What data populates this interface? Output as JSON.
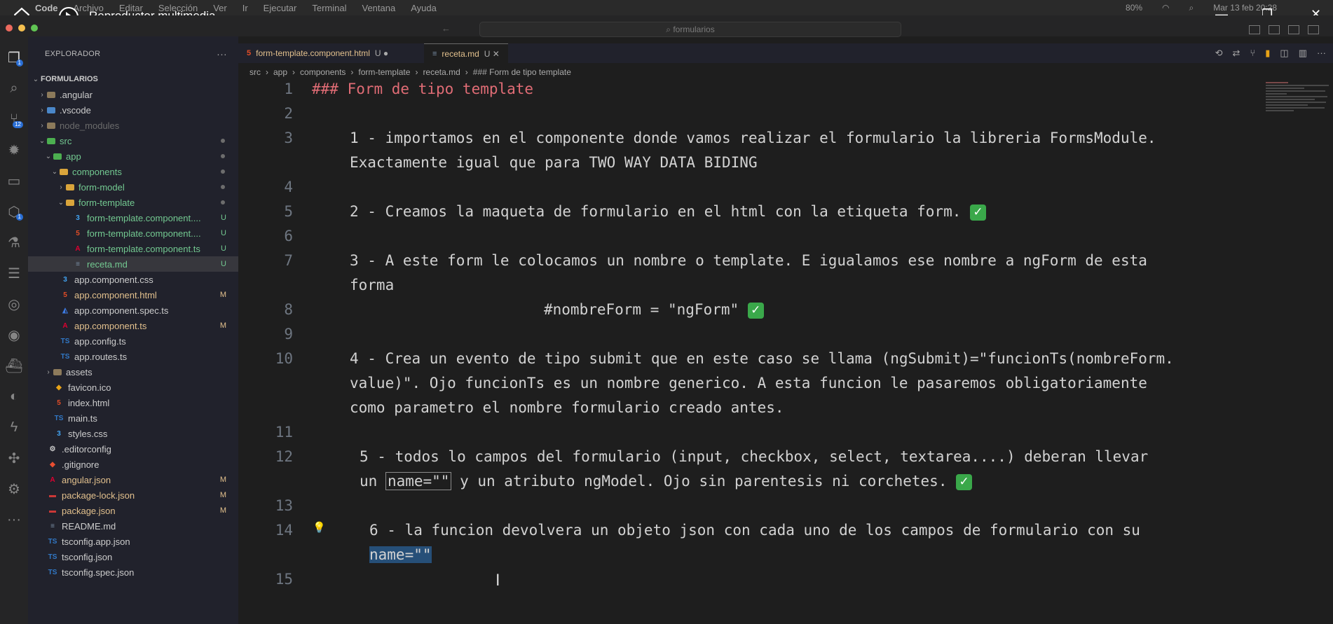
{
  "mac_menu": {
    "app": "Code",
    "items": [
      "Archivo",
      "Editar",
      "Selección",
      "Ver",
      "Ir",
      "Ejecutar",
      "Terminal",
      "Ventana",
      "Ayuda"
    ],
    "battery": "80%",
    "datetime": "Mar 13 feb 20:28"
  },
  "player": {
    "title": "Reproductor multimedia",
    "home_icon": "home-icon",
    "play_icon": "play-icon",
    "minimize": "—",
    "restore": "❐",
    "close": "✕"
  },
  "window": {
    "search_placeholder": "formularios"
  },
  "activity_bar": {
    "explorer_badge": "1",
    "scm_badge": "12",
    "remote_badge": "1",
    "more": "···"
  },
  "sidebar": {
    "title": "EXPLORADOR",
    "more": "···",
    "tree": [
      {
        "name": "FORMULARIOS",
        "icon": "",
        "chev": "⌄",
        "status": "",
        "indent": 0,
        "root": true
      },
      {
        "name": ".angular",
        "icon": "folder",
        "chev": "›",
        "status": "",
        "indent": 1
      },
      {
        "name": ".vscode",
        "icon": "folder-blue",
        "chev": "›",
        "status": "",
        "indent": 1
      },
      {
        "name": "node_modules",
        "icon": "folder",
        "chev": "›",
        "status": "",
        "indent": 1,
        "dim": true
      },
      {
        "name": "src",
        "icon": "folder-green",
        "chev": "⌄",
        "status": "dot",
        "indent": 1
      },
      {
        "name": "app",
        "icon": "folder-green",
        "chev": "⌄",
        "status": "dot",
        "indent": 2
      },
      {
        "name": "components",
        "icon": "folder-yellow",
        "chev": "⌄",
        "status": "dot",
        "indent": 3
      },
      {
        "name": "form-model",
        "icon": "folder-yellow",
        "chev": "›",
        "status": "dot",
        "indent": 4
      },
      {
        "name": "form-template",
        "icon": "folder-yellow",
        "chev": "⌄",
        "status": "dot",
        "indent": 4
      },
      {
        "name": "form-template.component....",
        "icon": "css",
        "chev": "",
        "status": "U",
        "indent": 5
      },
      {
        "name": "form-template.component....",
        "icon": "html",
        "chev": "",
        "status": "U",
        "indent": 5
      },
      {
        "name": "form-template.component.ts",
        "icon": "angular",
        "chev": "",
        "status": "U",
        "indent": 5
      },
      {
        "name": "receta.md",
        "icon": "md",
        "chev": "",
        "status": "U",
        "indent": 5,
        "selected": true
      },
      {
        "name": "app.component.css",
        "icon": "css",
        "chev": "",
        "status": "",
        "indent": 3
      },
      {
        "name": "app.component.html",
        "icon": "html",
        "chev": "",
        "status": "M",
        "indent": 3
      },
      {
        "name": "app.component.spec.ts",
        "icon": "spec",
        "chev": "",
        "status": "",
        "indent": 3
      },
      {
        "name": "app.component.ts",
        "icon": "angular",
        "chev": "",
        "status": "M",
        "indent": 3
      },
      {
        "name": "app.config.ts",
        "icon": "ts",
        "chev": "",
        "status": "",
        "indent": 3
      },
      {
        "name": "app.routes.ts",
        "icon": "ts",
        "chev": "",
        "status": "",
        "indent": 3
      },
      {
        "name": "assets",
        "icon": "folder",
        "chev": "›",
        "status": "",
        "indent": 2
      },
      {
        "name": "favicon.ico",
        "icon": "ico",
        "chev": "",
        "status": "",
        "indent": 2
      },
      {
        "name": "index.html",
        "icon": "html",
        "chev": "",
        "status": "",
        "indent": 2
      },
      {
        "name": "main.ts",
        "icon": "ts",
        "chev": "",
        "status": "",
        "indent": 2
      },
      {
        "name": "styles.css",
        "icon": "css",
        "chev": "",
        "status": "",
        "indent": 2
      },
      {
        "name": ".editorconfig",
        "icon": "gear",
        "chev": "",
        "status": "",
        "indent": 1
      },
      {
        "name": ".gitignore",
        "icon": "git",
        "chev": "",
        "status": "",
        "indent": 1
      },
      {
        "name": "angular.json",
        "icon": "angular",
        "chev": "",
        "status": "M",
        "indent": 1
      },
      {
        "name": "package-lock.json",
        "icon": "npm",
        "chev": "",
        "status": "M",
        "indent": 1
      },
      {
        "name": "package.json",
        "icon": "npm",
        "chev": "",
        "status": "M",
        "indent": 1
      },
      {
        "name": "README.md",
        "icon": "md",
        "chev": "",
        "status": "",
        "indent": 1
      },
      {
        "name": "tsconfig.app.json",
        "icon": "tsconfig",
        "chev": "",
        "status": "",
        "indent": 1
      },
      {
        "name": "tsconfig.json",
        "icon": "tsconfig",
        "chev": "",
        "status": "",
        "indent": 1
      },
      {
        "name": "tsconfig.spec.json",
        "icon": "tsconfig",
        "chev": "",
        "status": "",
        "indent": 1
      }
    ]
  },
  "tabs": [
    {
      "label": "form-template.component.html",
      "mark": "U ●",
      "icon": "html",
      "active": false
    },
    {
      "label": "receta.md",
      "mark": "U ✕",
      "icon": "md",
      "active": true
    }
  ],
  "breadcrumb": [
    "src",
    "app",
    "components",
    "form-template",
    "receta.md",
    "### Form de tipo template"
  ],
  "editor": {
    "lines": [
      {
        "num": "1",
        "segments": [
          {
            "text": "### Form de tipo template",
            "style": "heading"
          }
        ]
      },
      {
        "num": "2",
        "segments": []
      },
      {
        "num": "3",
        "segments": [
          {
            "text": "1 - importamos en el componente donde vamos realizar el formulario la libreria FormsModule."
          }
        ]
      },
      {
        "num": "",
        "segments": [
          {
            "text": "Exactamente igual que para TWO WAY DATA BIDING"
          }
        ]
      },
      {
        "num": "4",
        "segments": []
      },
      {
        "num": "5",
        "segments": [
          {
            "text": "2 - Creamos la maqueta de formulario en el html con la etiqueta form. "
          },
          {
            "text": "✓",
            "style": "check"
          }
        ]
      },
      {
        "num": "6",
        "segments": []
      },
      {
        "num": "7",
        "segments": [
          {
            "text": "3 - A este form le colocamos un nombre o template. E igualamos ese nombre a ngForm de esta"
          }
        ]
      },
      {
        "num": "",
        "segments": [
          {
            "text": "forma"
          }
        ]
      },
      {
        "num": "8",
        "segments": [
          {
            "text": "#nombreForm = \"ngForm\" "
          },
          {
            "text": "✓",
            "style": "check"
          }
        ]
      },
      {
        "num": "9",
        "segments": []
      },
      {
        "num": "10",
        "segments": [
          {
            "text": "4 - Crea un evento de tipo submit que en este caso se llama (ngSubmit)=\"funcionTs(nombreForm."
          }
        ]
      },
      {
        "num": "",
        "segments": [
          {
            "text": "value)\". Ojo funcionTs es un nombre generico. A esta funcion le pasaremos obligatoriamente"
          }
        ]
      },
      {
        "num": "",
        "segments": [
          {
            "text": "como parametro el nombre formulario creado antes."
          }
        ]
      },
      {
        "num": "11",
        "segments": []
      },
      {
        "num": "12",
        "segments": [
          {
            "text": "5 - todos lo campos del formulario (input, checkbox, select, textarea....) deberan llevar"
          }
        ]
      },
      {
        "num": "",
        "segments": [
          {
            "text": "un "
          },
          {
            "text": "name=\"\"",
            "style": "boxed"
          },
          {
            "text": " y un atributo ngModel. Ojo sin parentesis ni corchetes.  "
          },
          {
            "text": "✓",
            "style": "check"
          }
        ]
      },
      {
        "num": "13",
        "segments": []
      },
      {
        "num": "14",
        "segments": [
          {
            "text": "6 - la funcion devolvera un objeto json con cada uno de los campos de formulario con su"
          }
        ]
      },
      {
        "num": "",
        "segments": [
          {
            "text": "name=\"\"",
            "style": "selected"
          }
        ]
      },
      {
        "num": "15",
        "segments": []
      }
    ]
  },
  "colors": {
    "heading": "#e06c75",
    "accent_blue": "#2a6fd6",
    "check_green": "#3aa84a"
  }
}
